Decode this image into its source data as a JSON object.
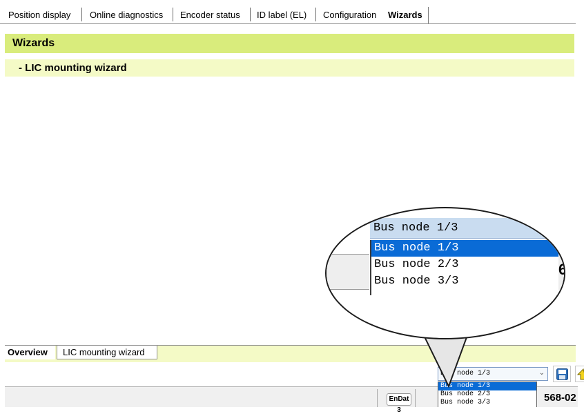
{
  "tabs": [
    {
      "label": "Position display"
    },
    {
      "label": "Online diagnostics"
    },
    {
      "label": "Encoder status"
    },
    {
      "label": "ID label (EL)"
    },
    {
      "label": "Configuration"
    },
    {
      "label": "Wizards"
    }
  ],
  "active_tab": "Wizards",
  "header": {
    "title": "Wizards",
    "subtitle": "- LIC mounting wizard"
  },
  "bottom_tabs": [
    {
      "label": "Overview"
    },
    {
      "label": "LIC mounting wizard"
    }
  ],
  "bus_node": {
    "selected": "Bus node 1/3",
    "options": [
      "Bus node 1/3",
      "Bus node 2/3",
      "Bus node 3/3"
    ]
  },
  "status": {
    "interface": "EnDat 3",
    "part_suffix": "568-02"
  },
  "magnifier": {
    "right_edge_glyph": "6",
    "right_edge_glyph2": "6"
  },
  "colors": {
    "header_green": "#d9ec7c",
    "subheader_green": "#f4fac6",
    "selection_blue": "#0a6bd6"
  }
}
